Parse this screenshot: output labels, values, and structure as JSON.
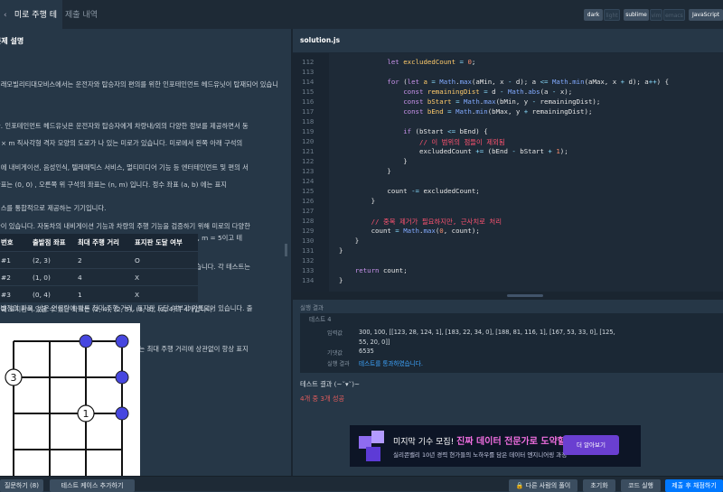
{
  "topbar": {
    "tabs": [
      {
        "label": "미로 주행 테스트",
        "active": true
      },
      {
        "label": "제출 내역",
        "active": false
      }
    ],
    "theme_options": [
      "dark",
      "light"
    ],
    "editor_options": [
      "sublime",
      "vim",
      "emacs"
    ],
    "language": "JavaScript"
  },
  "problem": {
    "section_title": "문제 설명",
    "para1": [
      "미래모빌리티대모비스에서는 운전자와 탑승자의 편의를 위한 인포테인먼트 헤드유닛이 탑재되어 있습니",
      "다. 인포테인먼트 헤드유닛은 운전자와 탑승자에게 차량내/외의 다양한 정보를 제공하면서 동",
      "시에 내비게이션, 음성인식, 텔레매틱스 서비스, 멀티미디어 기능 등 엔터테인먼트 및 편의 서",
      "비스를 통합적으로 제공하는 기기입니다."
    ],
    "para2": [
      "n × m 직사각형 격자 모양의 도로가 나 있는 미로가 있습니다. 미로에서 왼쪽 아래 구석의",
      "좌표는 (0, 0) , 오른쪽 위 구석의 좌표는 (n, m) 입니다. 정수 좌표 (a, b) 에는 표지",
      "판이 있습니다. 자동차의 내비게이션 기능과 차량의 주행 기능을 검증하기 위해 미로의 다양한",
      "위치에서 출발하여 표지판까지 최단 경로를 따라 이동한 테스트 기록이 있습니다. 각 테스트는",
      "출발점의 좌표, 남은 연료량에 따른 최대 주행 거리, 표지판 도달 여부가 기록되어 있습니다. 출",
      "발점의 위치와 표지판의 위치가 같을 수 있으며, 이때는 최대 주행 거리에 상관없이 항상 표지",
      "판에 도달한 것으로 간주합니다."
    ],
    "para3": [
      "테스트 기록을 토대로 표지판의 위치를 알아내려 합니다. 예를 들어 n = 3, m = 5이고 테",
      "스트 기록이 다음과 같은 경우를 생각해 봅시다."
    ],
    "table": {
      "headers": [
        "번호",
        "출발점 좌표",
        "최대 주행 거리",
        "표지판 도달 여부"
      ],
      "rows": [
        [
          "#1",
          "(2, 3)",
          "2",
          "O"
        ],
        [
          "#2",
          "(1, 0)",
          "4",
          "X"
        ],
        [
          "#3",
          "(0, 4)",
          "1",
          "X"
        ]
      ]
    },
    "caption": "이때 표지판이 있을 수 있는 좌표는 (2, 4), (2, 5), (3, 3), (3, 4)의 4개입니다.",
    "diagram_labels": [
      "3",
      "1"
    ]
  },
  "editor": {
    "filename": "solution.js",
    "line_numbers": [
      "112",
      "113",
      "114",
      "115",
      "116",
      "117",
      "118",
      "119",
      "120",
      "121",
      "122",
      "123",
      "124",
      "125",
      "126",
      "127",
      "128",
      "129",
      "130",
      "131",
      "132",
      "133",
      "134"
    ]
  },
  "result": {
    "title": "실행 결과",
    "test_label": "테스트 4",
    "rows": [
      {
        "key": "입력값",
        "value": "300, 100, [[123, 28, 124, 1], [183, 22, 34, 0], [188, 81, 116, 1], [167, 53, 33, 0], [125,\n55, 20, 0]]"
      },
      {
        "key": "기댓값",
        "value": "6535"
      },
      {
        "key": "실행 결과",
        "value": "테스트를 통과하였습니다."
      }
    ],
    "summary": "테스트 결과 (~˘▾˘)~",
    "score": "4개 중 3개 성공"
  },
  "ad": {
    "headline_prefix": "미지막 기수 모집!",
    "headline_highlight": "진짜 데이터 전문가로 도약할 시간",
    "sub": "실리콘밸리 10년 경력 현가들의 노하우를 담은 데이터 엔지니어링 과정",
    "button": "더 알아보기"
  },
  "bottombar": {
    "question": "질문하기 (8)",
    "add_testcase": "테스트 케이스 추가하기",
    "other_solutions": "다른 사람의 풀이",
    "reset": "초기화",
    "run": "코드 실행",
    "submit": "제출 후 채점하기"
  },
  "colors": {
    "accent_blue": "#0078ff",
    "grid_node": "#4747e0",
    "fail_red": "#e25c5c"
  }
}
